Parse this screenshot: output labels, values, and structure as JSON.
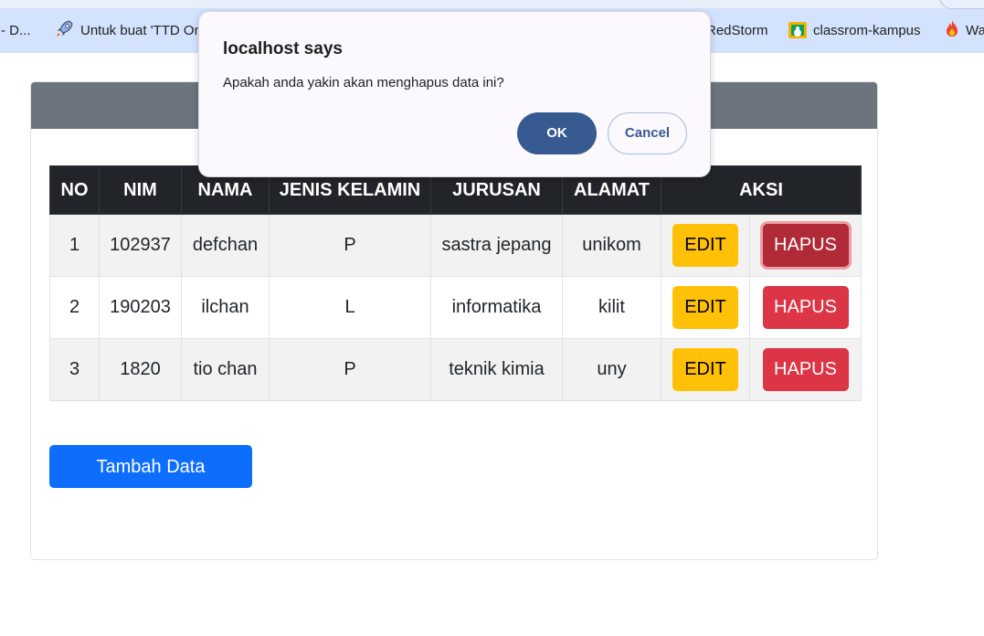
{
  "bookmarks": {
    "items": [
      {
        "label": "- D...",
        "icon": "none"
      },
      {
        "label": "Untuk buat 'TTD On",
        "icon": "rocket-icon"
      },
      {
        "label": "RedStorm",
        "icon": "none"
      },
      {
        "label": "classrom-kampus",
        "icon": "google-classroom-icon"
      },
      {
        "label": "Wa",
        "icon": "fire-icon"
      }
    ]
  },
  "dialog": {
    "title": "localhost says",
    "message": "Apakah anda yakin akan menghapus data ini?",
    "ok_label": "OK",
    "cancel_label": "Cancel"
  },
  "table": {
    "headers": [
      "NO",
      "NIM",
      "NAMA",
      "JENIS KELAMIN",
      "JURUSAN",
      "ALAMAT",
      "AKSI"
    ],
    "rows": [
      {
        "no": "1",
        "nim": "102937",
        "nama": "defchan",
        "jk": "P",
        "jurusan": "sastra jepang",
        "alamat": "unikom",
        "edit": "EDIT",
        "hapus": "HAPUS"
      },
      {
        "no": "2",
        "nim": "190203",
        "nama": "ilchan",
        "jk": "L",
        "jurusan": "informatika",
        "alamat": "kilit",
        "edit": "EDIT",
        "hapus": "HAPUS"
      },
      {
        "no": "3",
        "nim": "1820",
        "nama": "tio chan",
        "jk": "P",
        "jurusan": "teknik kimia",
        "alamat": "uny",
        "edit": "EDIT",
        "hapus": "HAPUS"
      }
    ]
  },
  "tambah_label": "Tambah Data",
  "colors": {
    "header_bar": "#6c757d",
    "table_head": "#212529",
    "edit": "#ffc107",
    "hapus": "#dc3545",
    "tambah": "#0d6efd",
    "dialog_ok": "#375b91"
  }
}
